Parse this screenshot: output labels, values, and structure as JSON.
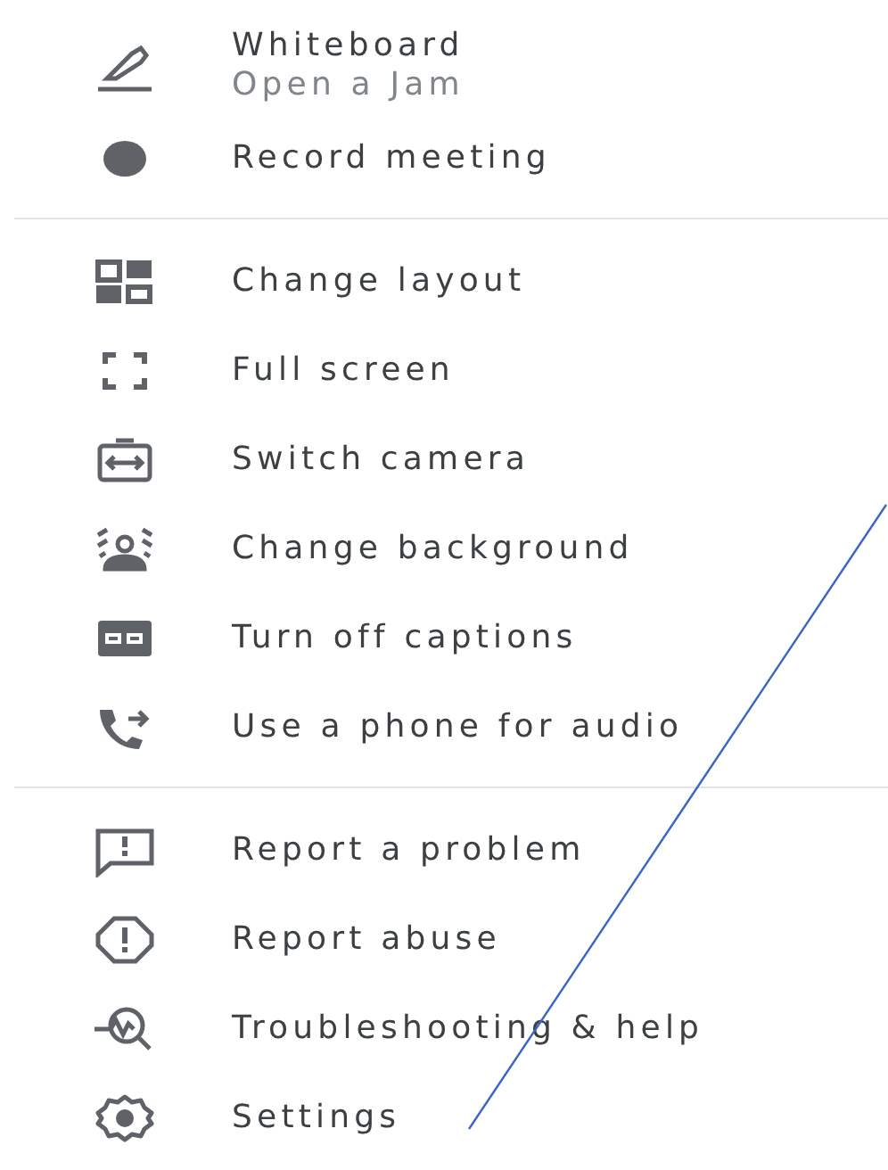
{
  "sections": [
    {
      "items": [
        {
          "label": "Whiteboard",
          "sublabel": "Open a Jam"
        },
        {
          "label": "Record meeting"
        }
      ]
    },
    {
      "items": [
        {
          "label": "Change layout"
        },
        {
          "label": "Full screen"
        },
        {
          "label": "Switch camera"
        },
        {
          "label": "Change background"
        },
        {
          "label": "Turn off captions"
        },
        {
          "label": "Use a phone for audio"
        }
      ]
    },
    {
      "items": [
        {
          "label": "Report a problem"
        },
        {
          "label": "Report abuse"
        },
        {
          "label": "Troubleshooting & help"
        },
        {
          "label": "Settings"
        }
      ]
    }
  ]
}
